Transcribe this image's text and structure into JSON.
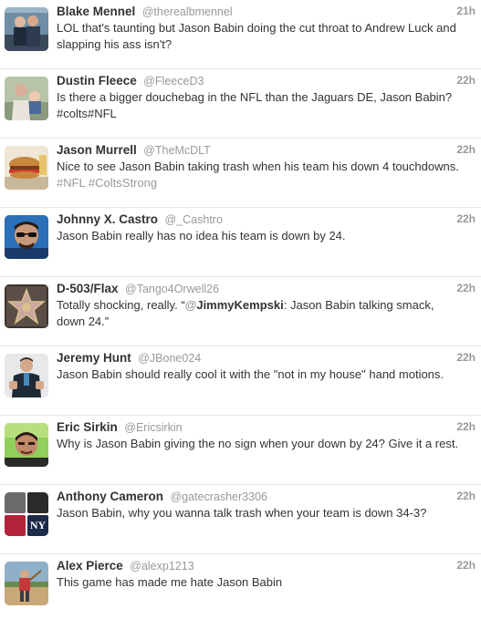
{
  "tweets": [
    {
      "fullname": "Blake Mennel",
      "username": "@therealbmennel",
      "time": "21h",
      "text": "LOL that's taunting but Jason Babin doing the cut throat to Andrew Luck and slapping his ass isn't?",
      "avatar_icon": "two-people-photo"
    },
    {
      "fullname": "Dustin Fleece",
      "username": "@FleeceD3",
      "time": "22h",
      "text": "Is there a bigger douchebag in the NFL than the Jaguars DE, Jason Babin? #colts#NFL",
      "avatar_icon": "man-holding-baby-photo"
    },
    {
      "fullname": "Jason Murrell",
      "username": "@TheMcDLT",
      "time": "22h",
      "text": "Nice to see Jason Babin taking trash when his team his down 4 touchdowns.",
      "hashtags": "#NFL #ColtsStrong",
      "avatar_icon": "burger-photo"
    },
    {
      "fullname": "Johnny X. Castro",
      "username": "@_Cashtro",
      "time": "22h",
      "text": "Jason Babin really has no idea his team is down by 24.",
      "avatar_icon": "man-with-sunglasses-photo"
    },
    {
      "fullname": "D-503/Flax",
      "username": "@Tango4Orwell26",
      "time": "22h",
      "text_before": "Totally shocking, really. “",
      "mention_at": "@",
      "mention_name": "JimmyKempski",
      "text_after": ": Jason Babin talking smack, down 24.”",
      "avatar_icon": "walk-of-fame-star-photo"
    },
    {
      "fullname": "Jeremy Hunt",
      "username": "@JBone024",
      "time": "22h",
      "text": "Jason Babin should really cool it with the \"not in my house\" hand motions.",
      "avatar_icon": "man-in-jacket-photo"
    },
    {
      "fullname": "Eric Sirkin",
      "username": "@Ericsirkin",
      "time": "22h",
      "text": "Why is Jason Babin giving the no sign when your down by 24? Give it a rest.",
      "avatar_icon": "man-portrait-photo"
    },
    {
      "fullname": "Anthony Cameron",
      "username": "@gatecrasher3306",
      "time": "22h",
      "text": "Jason Babin, why you wanna talk trash when your team is down 34-3?",
      "avatar_icon": "team-logos-grid"
    },
    {
      "fullname": "Alex Pierce",
      "username": "@alexp1213",
      "time": "22h",
      "text": "This game has made me hate Jason Babin",
      "avatar_icon": "kid-playing-baseball-photo"
    }
  ]
}
